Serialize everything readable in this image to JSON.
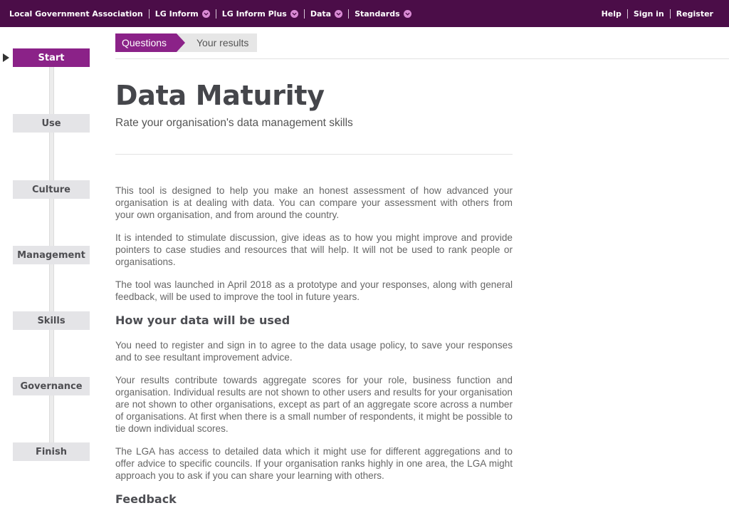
{
  "topnav": {
    "left": [
      {
        "label": "Local Government Association",
        "dropdown": false
      },
      {
        "label": "LG Inform",
        "dropdown": true
      },
      {
        "label": "LG Inform Plus",
        "dropdown": true
      },
      {
        "label": "Data",
        "dropdown": true
      },
      {
        "label": "Standards",
        "dropdown": true
      }
    ],
    "right": [
      "Help",
      "Sign in",
      "Register"
    ],
    "background": "#4b0d48",
    "accent": "#d98ad4",
    "dropdown_icon": "chevron-down-circle-icon"
  },
  "tabs": {
    "questions": "Questions",
    "results": "Your results"
  },
  "steps": [
    "Start",
    "Use",
    "Culture",
    "Management",
    "Skills",
    "Governance",
    "Finish"
  ],
  "active_step": "Start",
  "header": {
    "title": "Data Maturity",
    "subtitle": "Rate your organisation's data management skills"
  },
  "content": {
    "intro": [
      "This tool is designed to help you make an honest assessment of how advanced your organisation is at dealing with data. You can compare your assessment with others from your own organisation, and from around the country.",
      "It is intended to stimulate discussion, give ideas as to how you might improve and provide pointers to case studies and resources that will help. It will not be used to rank people or organisations.",
      "The tool was launched in April 2018 as a prototype and your responses, along with general feedback, will be used to improve the tool in future years."
    ],
    "section_heading": "How your data will be used",
    "section_paragraphs": [
      "You need to register and sign in to agree to the data usage policy, to save your responses and to see resultant improvement advice.",
      "Your results contribute towards aggregate scores for your role, business function and organisation. Individual results are not shown to other users and results for your organisation are not shown to other organisations, except as part of an aggregate score across a number of organisations. At first when there is a small number of respondents, it might be possible to tie down individual scores.",
      "The LGA has access to detailed data which it might use for different aggregations and to offer advice to specific councils. If your organisation ranks highly in one area, the LGA might approach you to ask if you can share your learning with others."
    ],
    "next_heading": "Feedback"
  },
  "colors": {
    "brand_purple": "#8b2288",
    "step_inactive": "#e4e4e7"
  }
}
